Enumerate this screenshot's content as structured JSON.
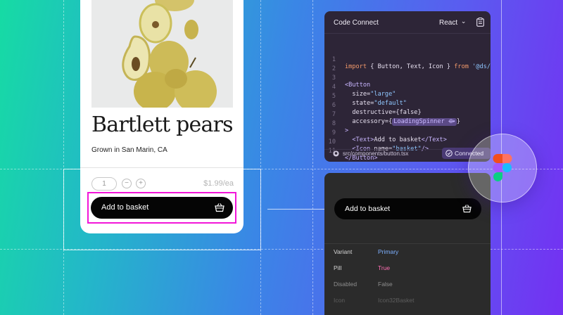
{
  "product_card": {
    "title": "Bartlett pears",
    "origin": "Grown in San Marin, CA",
    "quantity": "1",
    "minus_symbol": "−",
    "plus_symbol": "+",
    "price": "$1.99/ea",
    "button_label": "Add to basket",
    "button_icon": "basket-icon"
  },
  "code_panel": {
    "title": "Code Connect",
    "language": "React",
    "language_chevron": "⌄",
    "copy_icon": "clipboard-icon",
    "lines": [
      {
        "no": "1",
        "text": "import { Button, Text, Icon } from '@ds/co"
      },
      {
        "no": "2",
        "text": ""
      },
      {
        "no": "3",
        "text": "<Button"
      },
      {
        "no": "4",
        "text": "  size=\"large\""
      },
      {
        "no": "5",
        "text": "  state=\"default\""
      },
      {
        "no": "6",
        "text": "  destructive={false}"
      },
      {
        "no": "7",
        "text": "  accessory={"
      },
      {
        "no": "8",
        "text": ">"
      },
      {
        "no": "9",
        "text": "  <Text>Add to basket</Text>"
      },
      {
        "no": "10",
        "text": "  <Icon name=\"basket\"/>"
      },
      {
        "no": "11",
        "text": "</Button>"
      }
    ],
    "spinner_token": "LoadingSpinner ⟴",
    "line7_close": "}",
    "source_path": "src/components/button.tsx",
    "status_badge": "Connected",
    "colors": {
      "keyword": "#f39a6b",
      "string": "#8fc7ff",
      "tag": "#c9b6ff",
      "text": "#e7e0f0"
    }
  },
  "inspect_panel": {
    "button_label": "Add to basket",
    "button_icon": "basket-icon",
    "properties": [
      {
        "name": "Variant",
        "value": "Primary",
        "name_color": "#d6d6d6",
        "value_color": "#7db0ff"
      },
      {
        "name": "Pill",
        "value": "True",
        "name_color": "#d6d6d6",
        "value_color": "#ff6fb3"
      },
      {
        "name": "Disabled",
        "value": "False",
        "name_color": "#8e8e8e",
        "value_color": "#8e8e8e"
      },
      {
        "name": "Icon",
        "value": "Icon32Basket",
        "name_color": "#5e5e5e",
        "value_color": "#5e5e5e"
      }
    ]
  },
  "figma_badge": {
    "icon": "figma-logo-icon"
  },
  "colors": {
    "highlight": "#f216d9",
    "button_bg": "#050505",
    "card_bg": "#ffffff",
    "code_bg": "#2d2537",
    "inspect_bg": "#2b2b2b"
  }
}
